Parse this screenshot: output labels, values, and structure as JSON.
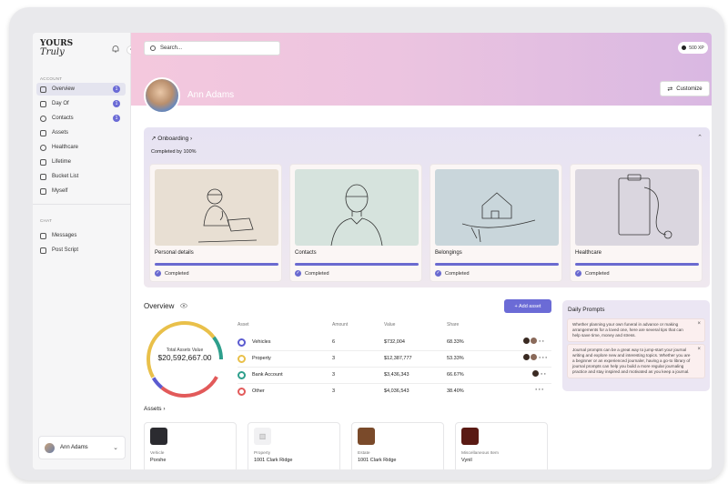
{
  "sidebar": {
    "logo_line1": "YOURS",
    "logo_line2": "Truly",
    "section_account": "ACCOUNT",
    "section_chat": "CHAT",
    "items": [
      {
        "label": "Overview",
        "badge": "1"
      },
      {
        "label": "Day Of",
        "badge": "1"
      },
      {
        "label": "Contacts",
        "badge": "1"
      },
      {
        "label": "Assets"
      },
      {
        "label": "Healthcare"
      },
      {
        "label": "Lifetime"
      },
      {
        "label": "Bucket List"
      },
      {
        "label": "Myself"
      }
    ],
    "chat_items": [
      {
        "label": "Messages"
      },
      {
        "label": "Post Script"
      }
    ],
    "user_name": "Ann Adams"
  },
  "header": {
    "search_placeholder": "Search...",
    "xp": "500 XP",
    "profile_name": "Ann Adams",
    "customize_label": "Customize"
  },
  "onboarding": {
    "title": "Onboarding",
    "completed_text": "Completed by 100%",
    "cards": [
      {
        "title": "Personal details",
        "status": "Completed"
      },
      {
        "title": "Contacts",
        "status": "Completed"
      },
      {
        "title": "Belongings",
        "status": "Completed"
      },
      {
        "title": "Healthcare",
        "status": "Completed"
      }
    ]
  },
  "overview": {
    "title": "Overview",
    "add_asset_label": "+ Add asset",
    "total_label": "Total Assets Value",
    "total_value": "$20,592,667.00",
    "columns": [
      "Asset",
      "Amount",
      "Value",
      "Share"
    ],
    "rows": [
      {
        "asset": "Vehicles",
        "amount": "6",
        "value": "$732,004",
        "share": "68.33%",
        "color": "#5b5bd0"
      },
      {
        "asset": "Property",
        "amount": "3",
        "value": "$12,387,777",
        "share": "53.33%",
        "color": "#e9c04a"
      },
      {
        "asset": "Bank Account",
        "amount": "3",
        "value": "$3,436,343",
        "share": "66.67%",
        "color": "#2e9f8c"
      },
      {
        "asset": "Other",
        "amount": "3",
        "value": "$4,036,543",
        "share": "38.40%",
        "color": "#e25a5a"
      }
    ]
  },
  "daily_prompts": {
    "title": "Daily Prompts",
    "prompts": [
      "Whether planning your own funeral in advance or making arrangements for a loved one, here are several tips that can help save time, money and stress.",
      "Journal prompts can be a great way to jump-start your journal writing and explore new and interesting topics. Whether you are a beginner or an experienced journaler, having a go-to library of journal prompts can help you build a more regular journaling practice and stay inspired and motivated as you keep a journal."
    ]
  },
  "assets": {
    "title": "Assets",
    "cards": [
      {
        "category": "Vehicle",
        "name": "Porshe"
      },
      {
        "category": "Property",
        "name": "1001 Clark Ridge"
      },
      {
        "category": "Estate",
        "name": "1001 Clark Ridge"
      },
      {
        "category": "Miscellaneous Item",
        "name": "Vynil"
      }
    ]
  }
}
